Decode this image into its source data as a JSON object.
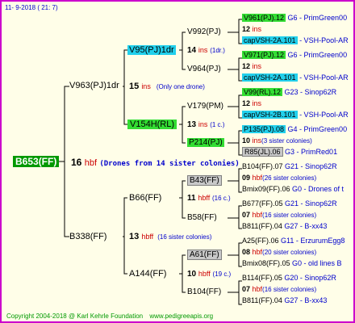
{
  "header": {
    "date": "11-  9-2018 (  21:  7)"
  },
  "root": {
    "name": "B653(FF)",
    "num": "16",
    "unit": "hbf",
    "comment": "(Drones from 14 sister colonies)"
  },
  "sire": {
    "name": "V963(PJ)1dr",
    "num": "15",
    "unit": "ins",
    "comment": "(Only one drone)"
  },
  "dam": {
    "name": "B338(FF)",
    "num": "13",
    "unit": "hbff",
    "comment": "(16 sister colonies)"
  },
  "sire_sire": {
    "name": "V95(PJ)1dr",
    "num": "14",
    "unit": "ins",
    "comment": "(1dr.)"
  },
  "sire_dam": {
    "name": "V154H(RL)",
    "num": "13",
    "unit": "ins",
    "comment": "(1 c.)"
  },
  "dam_sire": {
    "name": "B66(FF)",
    "num": "11",
    "unit": "hbff",
    "comment": "(16 c.)"
  },
  "dam_dam": {
    "name": "A144(FF)",
    "num": "10",
    "unit": "hbff",
    "comment": "(19 c.)"
  },
  "g3": [
    {
      "name": "V992(PJ)"
    },
    {
      "name": "V964(PJ)"
    },
    {
      "name": "V179(PM)"
    },
    {
      "name": "P214(PJ)"
    },
    {
      "name": "B43(FF)"
    },
    {
      "name": "B58(FF)"
    },
    {
      "name": "A61(FF)"
    },
    {
      "name": "B104(FF)"
    }
  ],
  "g4": [
    {
      "top": "V961(PJ).12",
      "top_ref": "G6 - PrimGreen00",
      "num": "12",
      "unit": "ins",
      "comment": "",
      "bottom": "capVSH-2A.101",
      "bottom_ref": "- VSH-Pool-AR"
    },
    {
      "top": "V971(PJ).12",
      "top_ref": "G6 - PrimGreen00",
      "num": "12",
      "unit": "ins",
      "comment": "",
      "bottom": "capVSH-2A.101",
      "bottom_ref": "- VSH-Pool-AR"
    },
    {
      "top": "V99(RL).12",
      "top_ref": "G23 - Sinop62R",
      "num": "12",
      "unit": "ins",
      "comment": "",
      "bottom": "capVSH-2B.101",
      "bottom_ref": "- VSH-Pool-AR"
    },
    {
      "top": "P135(PJ).08",
      "top_ref": "G4 - PrimGreen00",
      "num": "10",
      "unit": "ins",
      "comment": "(3 sister colonies)",
      "bottom": "R85(JL).06",
      "bottom_ref": "G3 - PrimRed01"
    },
    {
      "top": "B104(FF).07",
      "top_ref": "G21 - Sinop62R",
      "num": "09",
      "unit": "hbf",
      "comment": "(26 sister colonies)",
      "bottom": "Bmix09(FF).06",
      "bottom_ref": "G0 - Drones of t"
    },
    {
      "top": "B677(FF).05",
      "top_ref": "G21 - Sinop62R",
      "num": "07",
      "unit": "hbf",
      "comment": "(16 sister colonies)",
      "bottom": "B811(FF).04",
      "bottom_ref": "G27 - B-xx43"
    },
    {
      "top": "A25(FF).06",
      "top_ref": "G11 - ErzurumEgg8",
      "num": "08",
      "unit": "hbf",
      "comment": "(20 sister colonies)",
      "bottom": "Bmix08(FF).05",
      "bottom_ref": "G0 - old lines B"
    },
    {
      "top": "B114(FF).05",
      "top_ref": "G20 - Sinop62R",
      "num": "07",
      "unit": "hbf",
      "comment": "(16 sister colonies)",
      "bottom": "B811(FF).04",
      "bottom_ref": "G27 - B-xx43"
    }
  ],
  "footer": {
    "copyright": "Copyright 2004-2018 @ Karl Kehrle Foundation",
    "site": "www.pedigreeapis.org"
  }
}
